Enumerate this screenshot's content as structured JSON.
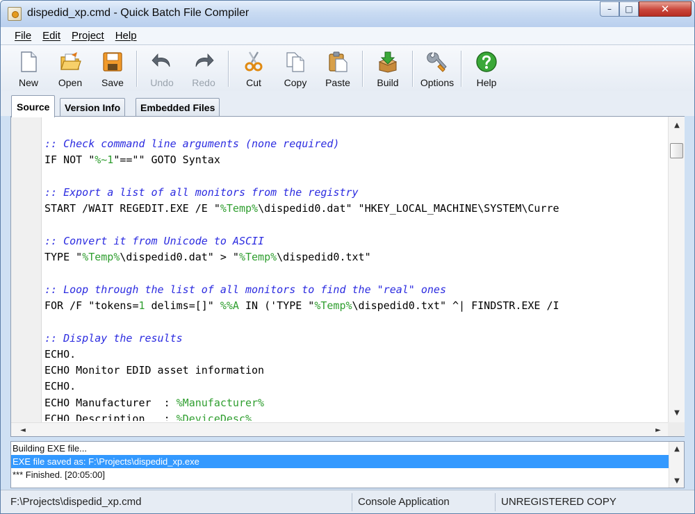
{
  "window": {
    "title": "dispedid_xp.cmd - Quick Batch File Compiler",
    "controls": {
      "minimize": "–",
      "maximize": "□",
      "close": "✕"
    }
  },
  "menu": {
    "items": [
      {
        "label": "File"
      },
      {
        "label": "Edit"
      },
      {
        "label": "Project"
      },
      {
        "label": "Help"
      }
    ]
  },
  "toolbar": {
    "new_label": "New",
    "open_label": "Open",
    "save_label": "Save",
    "undo_label": "Undo",
    "redo_label": "Redo",
    "cut_label": "Cut",
    "copy_label": "Copy",
    "paste_label": "Paste",
    "build_label": "Build",
    "options_label": "Options",
    "help_label": "Help",
    "disabled": [
      "Undo",
      "Redo"
    ]
  },
  "tabs": [
    {
      "label": "Source",
      "active": true
    },
    {
      "label": "Version Info",
      "active": false
    },
    {
      "label": "Embedded Files",
      "active": false
    }
  ],
  "editor": {
    "colors": {
      "comment": "#2b2be0",
      "variable": "#2f9e2f",
      "text": "#000000"
    },
    "lines": [
      ":: Check command line arguments (none required)",
      "IF NOT \"%~1\"==\"\" GOTO Syntax",
      "",
      ":: Export a list of all monitors from the registry",
      "START /WAIT REGEDIT.EXE /E \"%Temp%\\dispedid0.dat\" \"HKEY_LOCAL_MACHINE\\SYSTEM\\Curre",
      "",
      ":: Convert it from Unicode to ASCII",
      "TYPE \"%Temp%\\dispedid0.dat\" > \"%Temp%\\dispedid0.txt\"",
      "",
      ":: Loop through the list of all monitors to find the \"real\" ones",
      "FOR /F \"tokens=1 delims=[]\" %%A IN ('TYPE \"%Temp%\\dispedid0.txt\" ^| FINDSTR.EXE /I",
      "",
      ":: Display the results",
      "ECHO.",
      "ECHO Monitor EDID asset information",
      "ECHO.",
      "ECHO Manufacturer  : %Manufacturer%",
      "ECHO Description   : %DeviceDesc%"
    ]
  },
  "output": {
    "lines": [
      "Building EXE file...",
      "EXE file saved as: F:\\Projects\\dispedid_xp.exe",
      "*** Finished. [20:05:00]"
    ],
    "selected_index": 1,
    "selection_color": "#3399ff"
  },
  "status": {
    "path": "F:\\Projects\\dispedid_xp.cmd",
    "app_type": "Console Application",
    "registration": "UNREGISTERED COPY"
  },
  "icons": {
    "app": "batch-file-icon",
    "new": "new-document-icon",
    "open": "open-folder-icon",
    "save": "save-disk-icon",
    "undo": "undo-arrow-icon",
    "redo": "redo-arrow-icon",
    "cut": "scissors-icon",
    "copy": "copy-documents-icon",
    "paste": "clipboard-icon",
    "build": "build-box-icon",
    "options": "wrench-icon",
    "help": "help-question-icon"
  }
}
